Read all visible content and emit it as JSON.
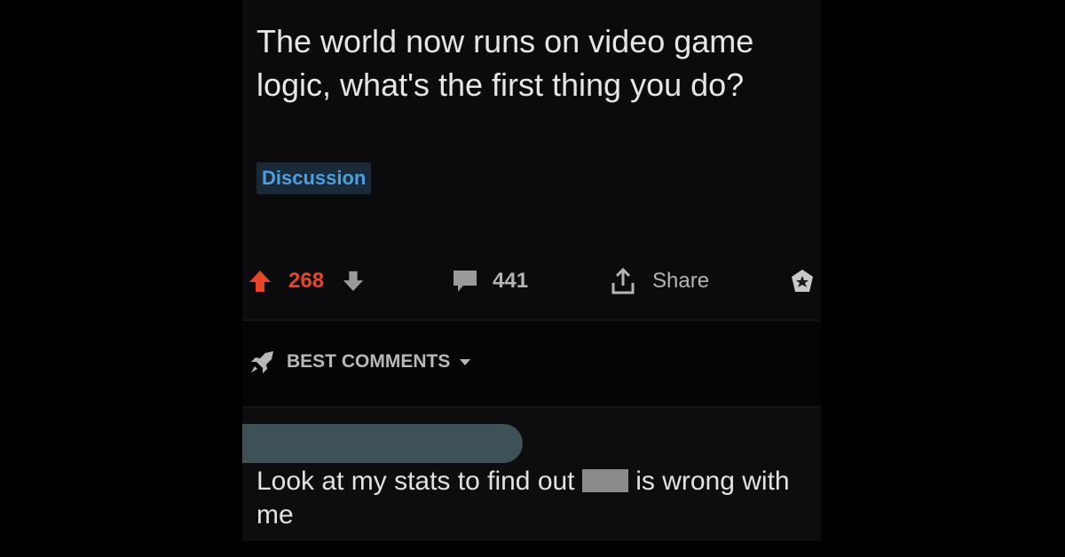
{
  "post": {
    "title": "The world now runs on video game logic, what's the first thing you do?",
    "flair": "Discussion"
  },
  "actions": {
    "upvotes": "268",
    "comments": "441",
    "share_label": "Share",
    "upvote_color": "#e8462a"
  },
  "sort": {
    "label": "BEST COMMENTS"
  },
  "comment": {
    "text_before": "Look at my stats to find out",
    "text_after": "is wrong with me"
  },
  "colors": {
    "background": "#0b0b0d",
    "flair_text": "#4aa0e0",
    "flair_bg": "#1a2a38",
    "redacted_username": "#3e5156"
  }
}
